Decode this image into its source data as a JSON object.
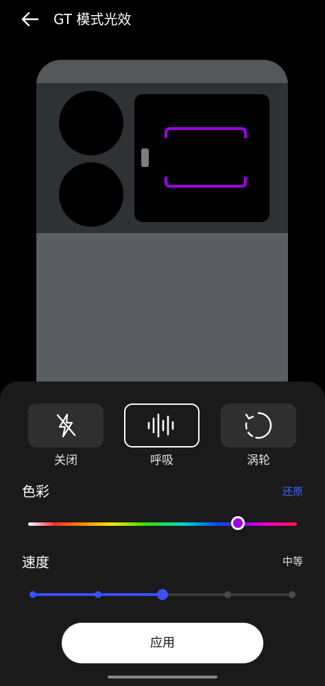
{
  "header": {
    "title": "GT 模式光效",
    "back_icon": "arrow-left-icon"
  },
  "preview": {
    "light_color": "#9b00e6"
  },
  "modes": [
    {
      "label": "关闭",
      "icon": "flash-off-icon",
      "selected": false
    },
    {
      "label": "呼吸",
      "icon": "waveform-icon",
      "selected": true
    },
    {
      "label": "涡轮",
      "icon": "rotate-icon",
      "selected": false
    }
  ],
  "color": {
    "title": "色彩",
    "reset_label": "还原",
    "selected_color": "#9b00e6",
    "position_fraction": 0.78
  },
  "speed": {
    "title": "速度",
    "value_label": "中等",
    "steps": 5,
    "current_step": 3
  },
  "apply_label": "应用",
  "colors": {
    "accent": "#3b4fff",
    "link": "#4a63ff",
    "sheet_bg": "#1a1a1a"
  }
}
